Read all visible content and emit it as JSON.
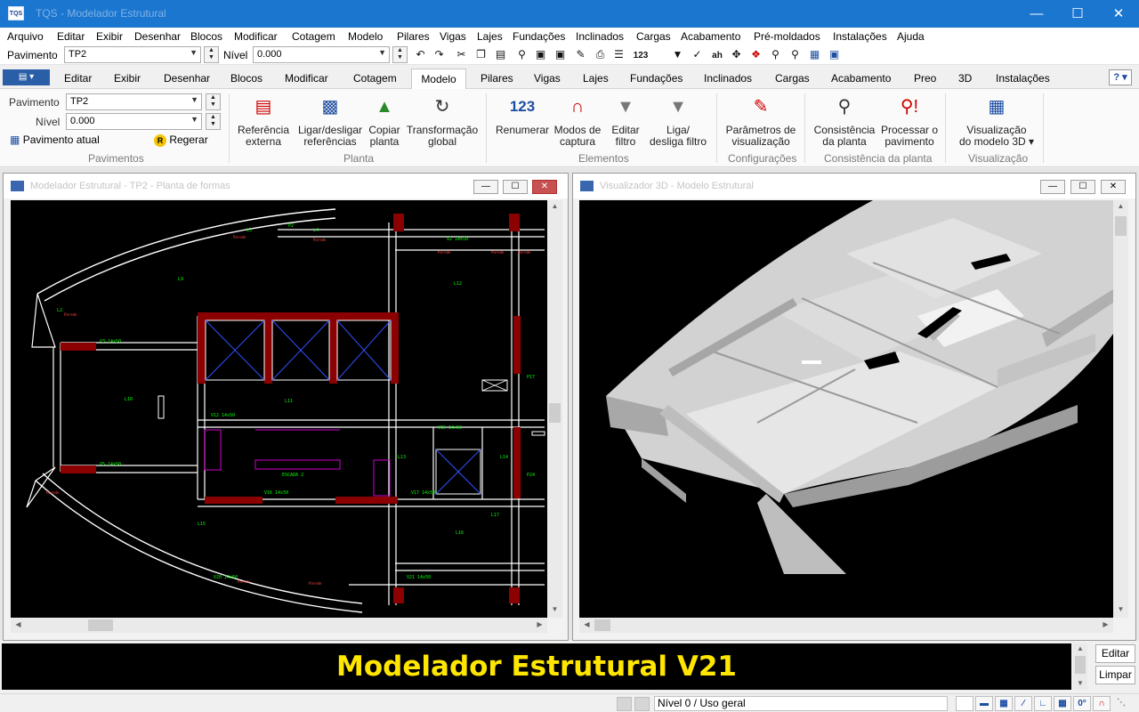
{
  "titlebar": {
    "app_icon": "TQS",
    "title": "TQS - Modelador Estrutural",
    "minimize_icon": "minimize-icon",
    "maximize_icon": "maximize-icon",
    "close_icon": "close-icon"
  },
  "menu": [
    "Arquivo",
    "Editar",
    "Exibir",
    "Desenhar",
    "Blocos",
    "Modificar",
    "Cotagem",
    "Modelo",
    "Pilares",
    "Vigas",
    "Lajes",
    "Fundações",
    "Inclinados",
    "Cargas",
    "Acabamento",
    "Pré-moldados",
    "Instalações",
    "Ajuda"
  ],
  "quickbar": {
    "pavimento_label": "Pavimento",
    "pavimento_value": "TP2",
    "nivel_label": "Nível",
    "nivel_value": "0.000",
    "icons": [
      "undo-icon",
      "redo-icon",
      "cut-icon",
      "copy-icon",
      "paste-icon",
      "find-icon",
      "save-icon",
      "save-as-icon",
      "edit-icon",
      "print-icon",
      "layers-icon",
      "renumber-icon",
      "filter-icon",
      "text-icon",
      "font-icon",
      "pan-icon",
      "bug-icon",
      "zoom-icon",
      "zoom-ref-icon",
      "building-icon",
      "view-icon"
    ],
    "renumber_text": "123",
    "font_text": "ah"
  },
  "ribbon_tabs": [
    "Editar",
    "Exibir",
    "Desenhar",
    "Blocos",
    "Modificar",
    "Cotagem",
    "Modelo",
    "Pilares",
    "Vigas",
    "Lajes",
    "Fundações",
    "Inclinados",
    "Cargas",
    "Acabamento",
    "Preo",
    "3D",
    "Instalações"
  ],
  "active_tab": "Modelo",
  "help": "?",
  "ribbon": {
    "pavimentos": {
      "pavimento_label": "Pavimento",
      "pavimento_value": "TP2",
      "nivel_label": "Nível",
      "nivel_value": "0.000",
      "pavimento_atual": "Pavimento atual",
      "regerar": "Regerar",
      "regerar_badge": "R",
      "group": "Pavimentos"
    },
    "planta": {
      "ref_externa": [
        "Referência",
        "externa"
      ],
      "ligar_ref": [
        "Ligar/desligar",
        "referências"
      ],
      "copiar_planta": [
        "Copiar",
        "planta"
      ],
      "transformacao": [
        "Transformação",
        "global"
      ],
      "group": "Planta"
    },
    "elementos": {
      "renumerar": "Renumerar",
      "renumerar_icon_text": "123",
      "modos_captura": [
        "Modos de",
        "captura"
      ],
      "editar_filtro": [
        "Editar",
        "filtro"
      ],
      "liga_filtro": [
        "Liga/",
        "desliga filtro"
      ],
      "group": "Elementos"
    },
    "configuracoes": {
      "parametros": [
        "Parâmetros de",
        "visualização"
      ],
      "group": "Configurações"
    },
    "consistencia": {
      "consistencia": [
        "Consistência",
        "da planta"
      ],
      "processar": [
        "Processar o",
        "pavimento"
      ],
      "group": "Consistência da planta"
    },
    "visualizacao": {
      "visualizacao3d": [
        "Visualização",
        "do modelo 3D ▾"
      ],
      "group": "Visualização"
    }
  },
  "windows": {
    "left_title": "Modelador Estrutural - TP2 - Planta de formas",
    "right_title": "Visualizador 3D - Modelo Estrutural"
  },
  "command": {
    "message": "Modelador Estrutural V21",
    "editar": "Editar",
    "limpar": "Limpar"
  },
  "status": {
    "text": "Nível 0 / Uso geral",
    "angle": "0°"
  },
  "colors": {
    "titlebar": "#1b76d0",
    "drawing_bg": "#000000",
    "column_fill": "#8b0000",
    "beam_line": "#ffffff",
    "labels_green": "#00ff00",
    "message_yellow": "#ffe600"
  }
}
